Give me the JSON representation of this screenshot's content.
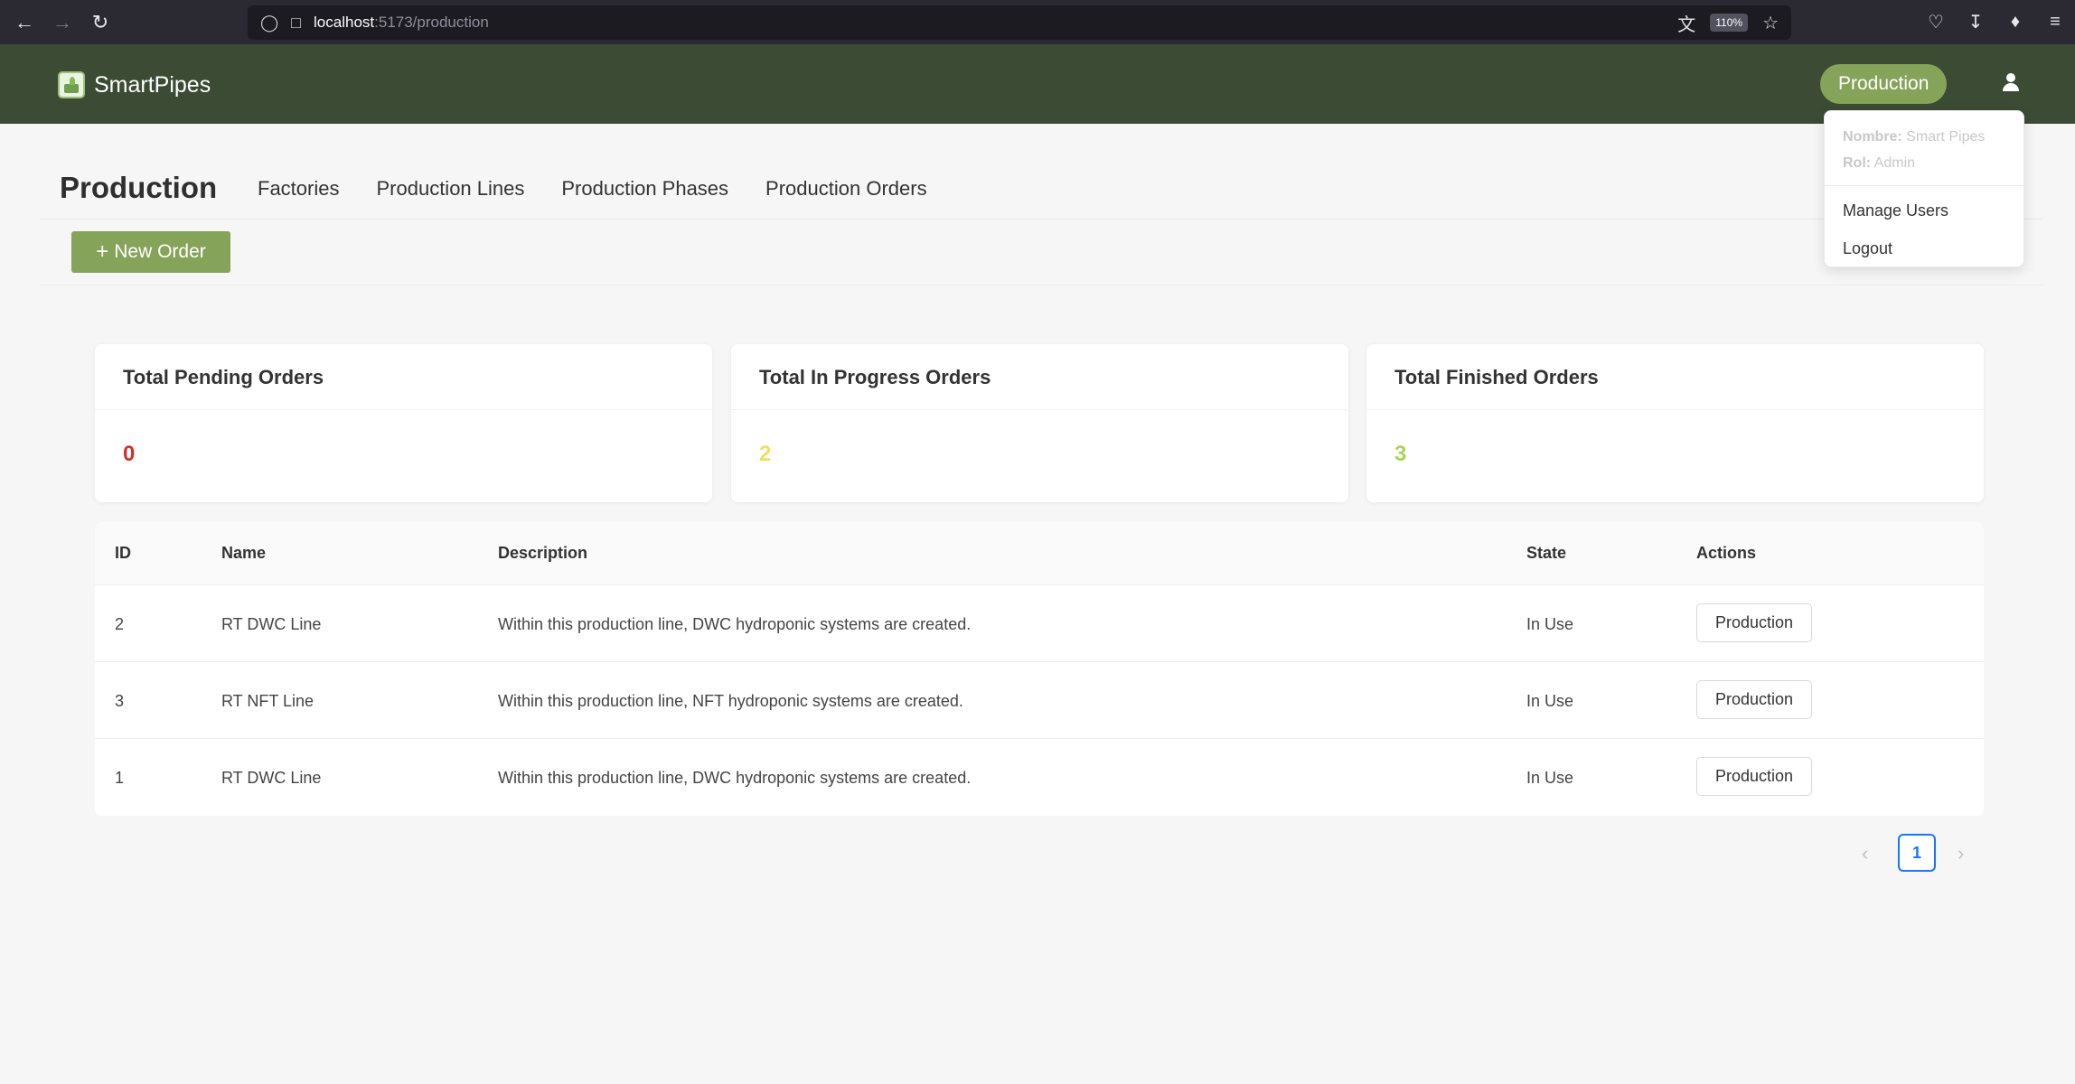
{
  "browser": {
    "url_host": "localhost",
    "url_path": ":5173/production",
    "zoom": "110%"
  },
  "header": {
    "brand": "SmartPipes",
    "role_button": "Production"
  },
  "user_menu": {
    "name_label": "Nombre:",
    "name_value": "Smart Pipes",
    "role_label": "Rol:",
    "role_value": "Admin",
    "items": [
      "Manage Users",
      "Logout"
    ]
  },
  "page": {
    "title": "Production",
    "tabs": [
      "Factories",
      "Production Lines",
      "Production Phases",
      "Production Orders"
    ],
    "new_order_label": "New Order"
  },
  "stats": [
    {
      "title": "Total Pending Orders",
      "value": "0",
      "color": "#d0312d"
    },
    {
      "title": "Total In Progress Orders",
      "value": "2",
      "color": "#f0e060"
    },
    {
      "title": "Total Finished Orders",
      "value": "3",
      "color": "#a6d65a"
    }
  ],
  "table": {
    "columns": [
      "ID",
      "Name",
      "Description",
      "State",
      "Actions"
    ],
    "rows": [
      {
        "id": "2",
        "name": "RT DWC Line",
        "description": "Within this production line, DWC hydroponic systems are created.",
        "state": "In Use",
        "action": "Production"
      },
      {
        "id": "3",
        "name": "RT NFT Line",
        "description": "Within this production line, NFT hydroponic systems are created.",
        "state": "In Use",
        "action": "Production"
      },
      {
        "id": "1",
        "name": "RT DWC Line",
        "description": "Within this production line, DWC hydroponic systems are created.",
        "state": "In Use",
        "action": "Production"
      }
    ]
  },
  "pagination": {
    "current": "1",
    "prev_icon": "chevron-left-icon",
    "next_icon": "chevron-right-icon"
  },
  "colors": {
    "header_bg": "#3c4b33",
    "accent": "#86a35a",
    "pagination_active": "#1677ff"
  }
}
